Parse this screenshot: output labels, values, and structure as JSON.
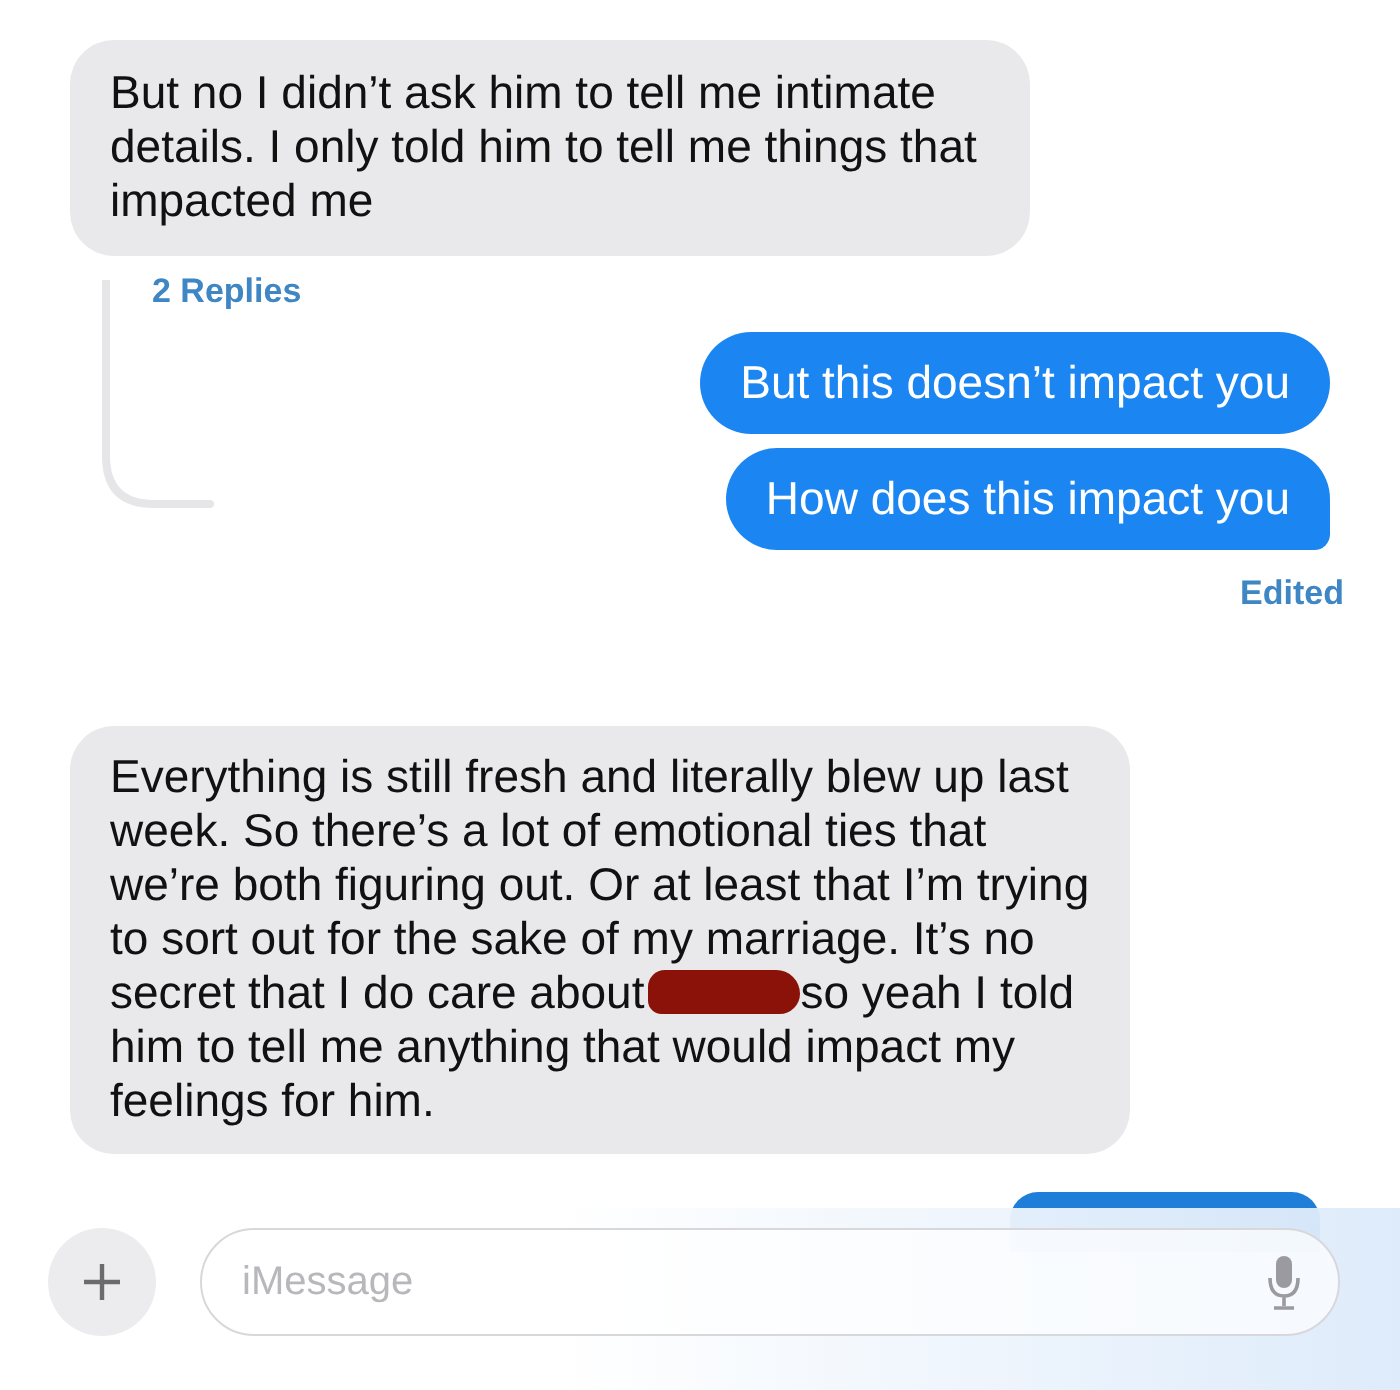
{
  "messages": [
    {
      "kind": "received",
      "text": "But no I didn’t ask him to tell me intimate details. I only told him to tell me things that impacted me",
      "replies": "2 Replies"
    },
    {
      "kind": "sent",
      "text": "But this doesn’t impact you",
      "tail": false
    },
    {
      "kind": "sent",
      "text": "How does this impact you",
      "tail": true,
      "status": "Edited"
    },
    {
      "kind": "received",
      "text": "Everything is still fresh and literally blew up last week. So there’s a lot of emotional ties that we’re both figuring out. Or at least that I’m trying to sort out for the sake of my marriage. It’s no secret that I do care about",
      "redacted": true,
      "text_after": "so yeah I told him to tell me anything that would impact my feelings for him."
    }
  ],
  "composer": {
    "placeholder": "iMessage"
  }
}
